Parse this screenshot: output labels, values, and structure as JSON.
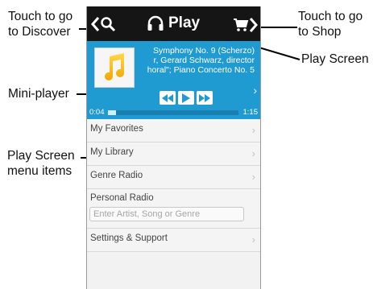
{
  "callouts": {
    "discover": [
      "Touch to go",
      "to Discover"
    ],
    "shop": [
      "Touch to go",
      "to Shop"
    ],
    "play_screen": "Play Screen",
    "mini_player": "Mini-player",
    "menu_items": [
      "Play Screen",
      "menu items"
    ]
  },
  "topbar": {
    "title": "Play",
    "icons": [
      "back-chevron-icon",
      "search-icon",
      "headphones-icon",
      "shopping-cart-icon",
      "forward-chevron-icon"
    ]
  },
  "mini_player": {
    "track_line1": "Symphony No. 9 (Scherzo)",
    "track_line2": "r, Gerard Schwarz, director",
    "track_line3": "horal\"; Piano Concerto No. 5",
    "time_elapsed": "0:04",
    "time_total": "1:15",
    "progress_fraction": 0.06,
    "next_icon": "chevron-right-icon"
  },
  "menu": {
    "items": [
      {
        "label": "My Favorites"
      },
      {
        "label": "My Library"
      },
      {
        "label": "Genre Radio"
      }
    ],
    "personal_radio": {
      "label": "Personal Radio",
      "placeholder": "Enter Artist, Song or Genre"
    },
    "settings": {
      "label": "Settings & Support"
    }
  },
  "colors": {
    "topbar_bg": "#151515",
    "mini_player_bg": "#1f9bd2",
    "menu_bg": "#f4f4f4"
  }
}
